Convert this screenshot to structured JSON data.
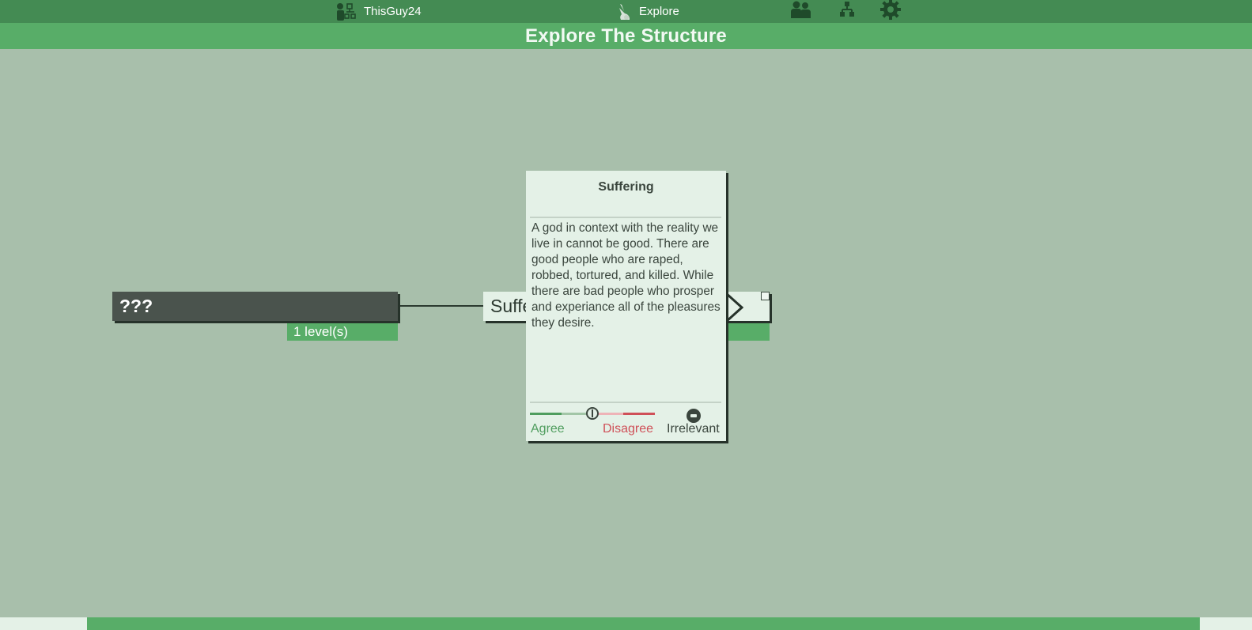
{
  "nav": {
    "username": "ThisGuy24",
    "explore_label": "Explore",
    "icons": [
      "user-structure-icon",
      "bunny-icon",
      "people-icon",
      "tree-icon",
      "gear-icon"
    ]
  },
  "page_title": "Explore The Structure",
  "parent_node": {
    "title": "???",
    "level_badge": "1 level(s)"
  },
  "child_node": {
    "title": "Suffering"
  },
  "popup": {
    "title": "Suffering",
    "body": "A god in context with the reality we live in cannot be good. There are good people who are raped, robbed, tortured, and killed. While there are bad people who prosper and experiance all of the pleasures they desire.",
    "agree_label": "Agree",
    "disagree_label": "Disagree",
    "irrelevant_label": "Irrelevant",
    "stance_level": 0.5
  },
  "colors": {
    "nav_bg": "#448b53",
    "accent": "#58ad68",
    "canvas_bg": "#a8bfab",
    "agree": "#4f9d5e",
    "disagree": "#cf5058",
    "card_bg": "#e4f1e7",
    "dark_node": "#4a534d"
  }
}
